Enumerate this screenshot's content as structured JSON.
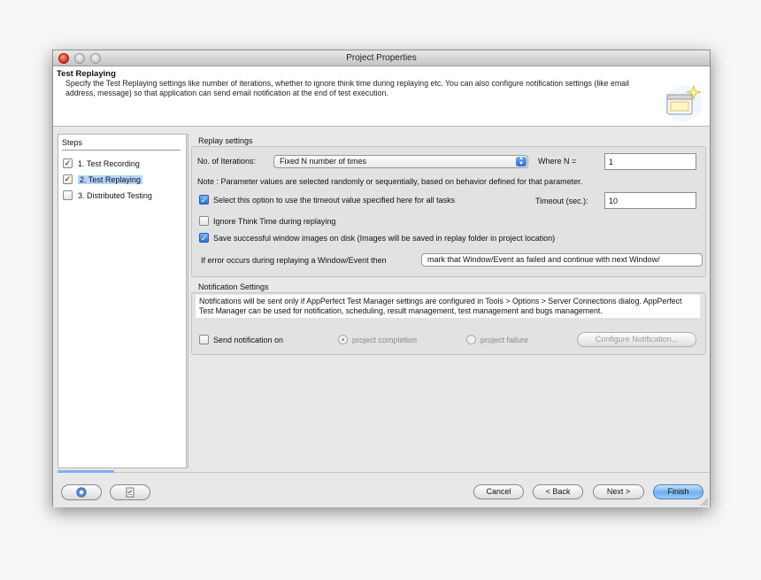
{
  "window": {
    "title": "Project Properties"
  },
  "header": {
    "title": "Test Replaying",
    "description": "Specify the Test Replaying settings like number of iterations, whether to ignore think time during replaying etc. You can also configure notification settings (like email address, message) so that application can send email notification at the end of test execution."
  },
  "steps": {
    "title": "Steps",
    "items": [
      {
        "label": "1. Test Recording",
        "checked": true,
        "selected": false
      },
      {
        "label": "2. Test Replaying",
        "checked": true,
        "selected": true
      },
      {
        "label": "3. Distributed Testing",
        "checked": false,
        "selected": false
      }
    ]
  },
  "replay": {
    "group_title": "Replay settings",
    "iterations_label": "No. of Iterations:",
    "iterations_value": "Fixed N number of times",
    "where_n_label": "Where N =",
    "where_n_value": "1",
    "note": "Note : Parameter values are selected randomly or sequentially, based on behavior defined for that parameter.",
    "timeout_check_label": "Select this option to use the timeout value specified here for all tasks",
    "timeout_label": "Timeout (sec.):",
    "timeout_value": "10",
    "ignore_think_label": "Ignore Think Time during replaying",
    "save_images_label": "Save successful window images on disk (Images will be saved in replay folder in project location)",
    "error_label": "If error occurs during replaying a Window/Event then",
    "error_value": "mark that Window/Event as failed and continue with next Window/"
  },
  "notification": {
    "group_title": "Notification Settings",
    "notice": "Notifications will be sent only if AppPerfect Test Manager settings are configured in Tools > Options > Server Connections dialog. AppPerfect Test Manager can be used for notification, scheduling, result management, test management and bugs management.",
    "send_label": "Send notification on",
    "radio_completion": "project completion",
    "radio_failure": "project failure",
    "configure_button": "Configure Notification..."
  },
  "footer": {
    "cancel": "Cancel",
    "back": "< Back",
    "next": "Next >",
    "finish": "Finish",
    "help_icon": "help-icon",
    "checklist_icon": "checklist-icon"
  },
  "colors": {
    "accent": "#2e72d2",
    "selection": "#b5d5ff",
    "close_button": "#d42a1a"
  }
}
